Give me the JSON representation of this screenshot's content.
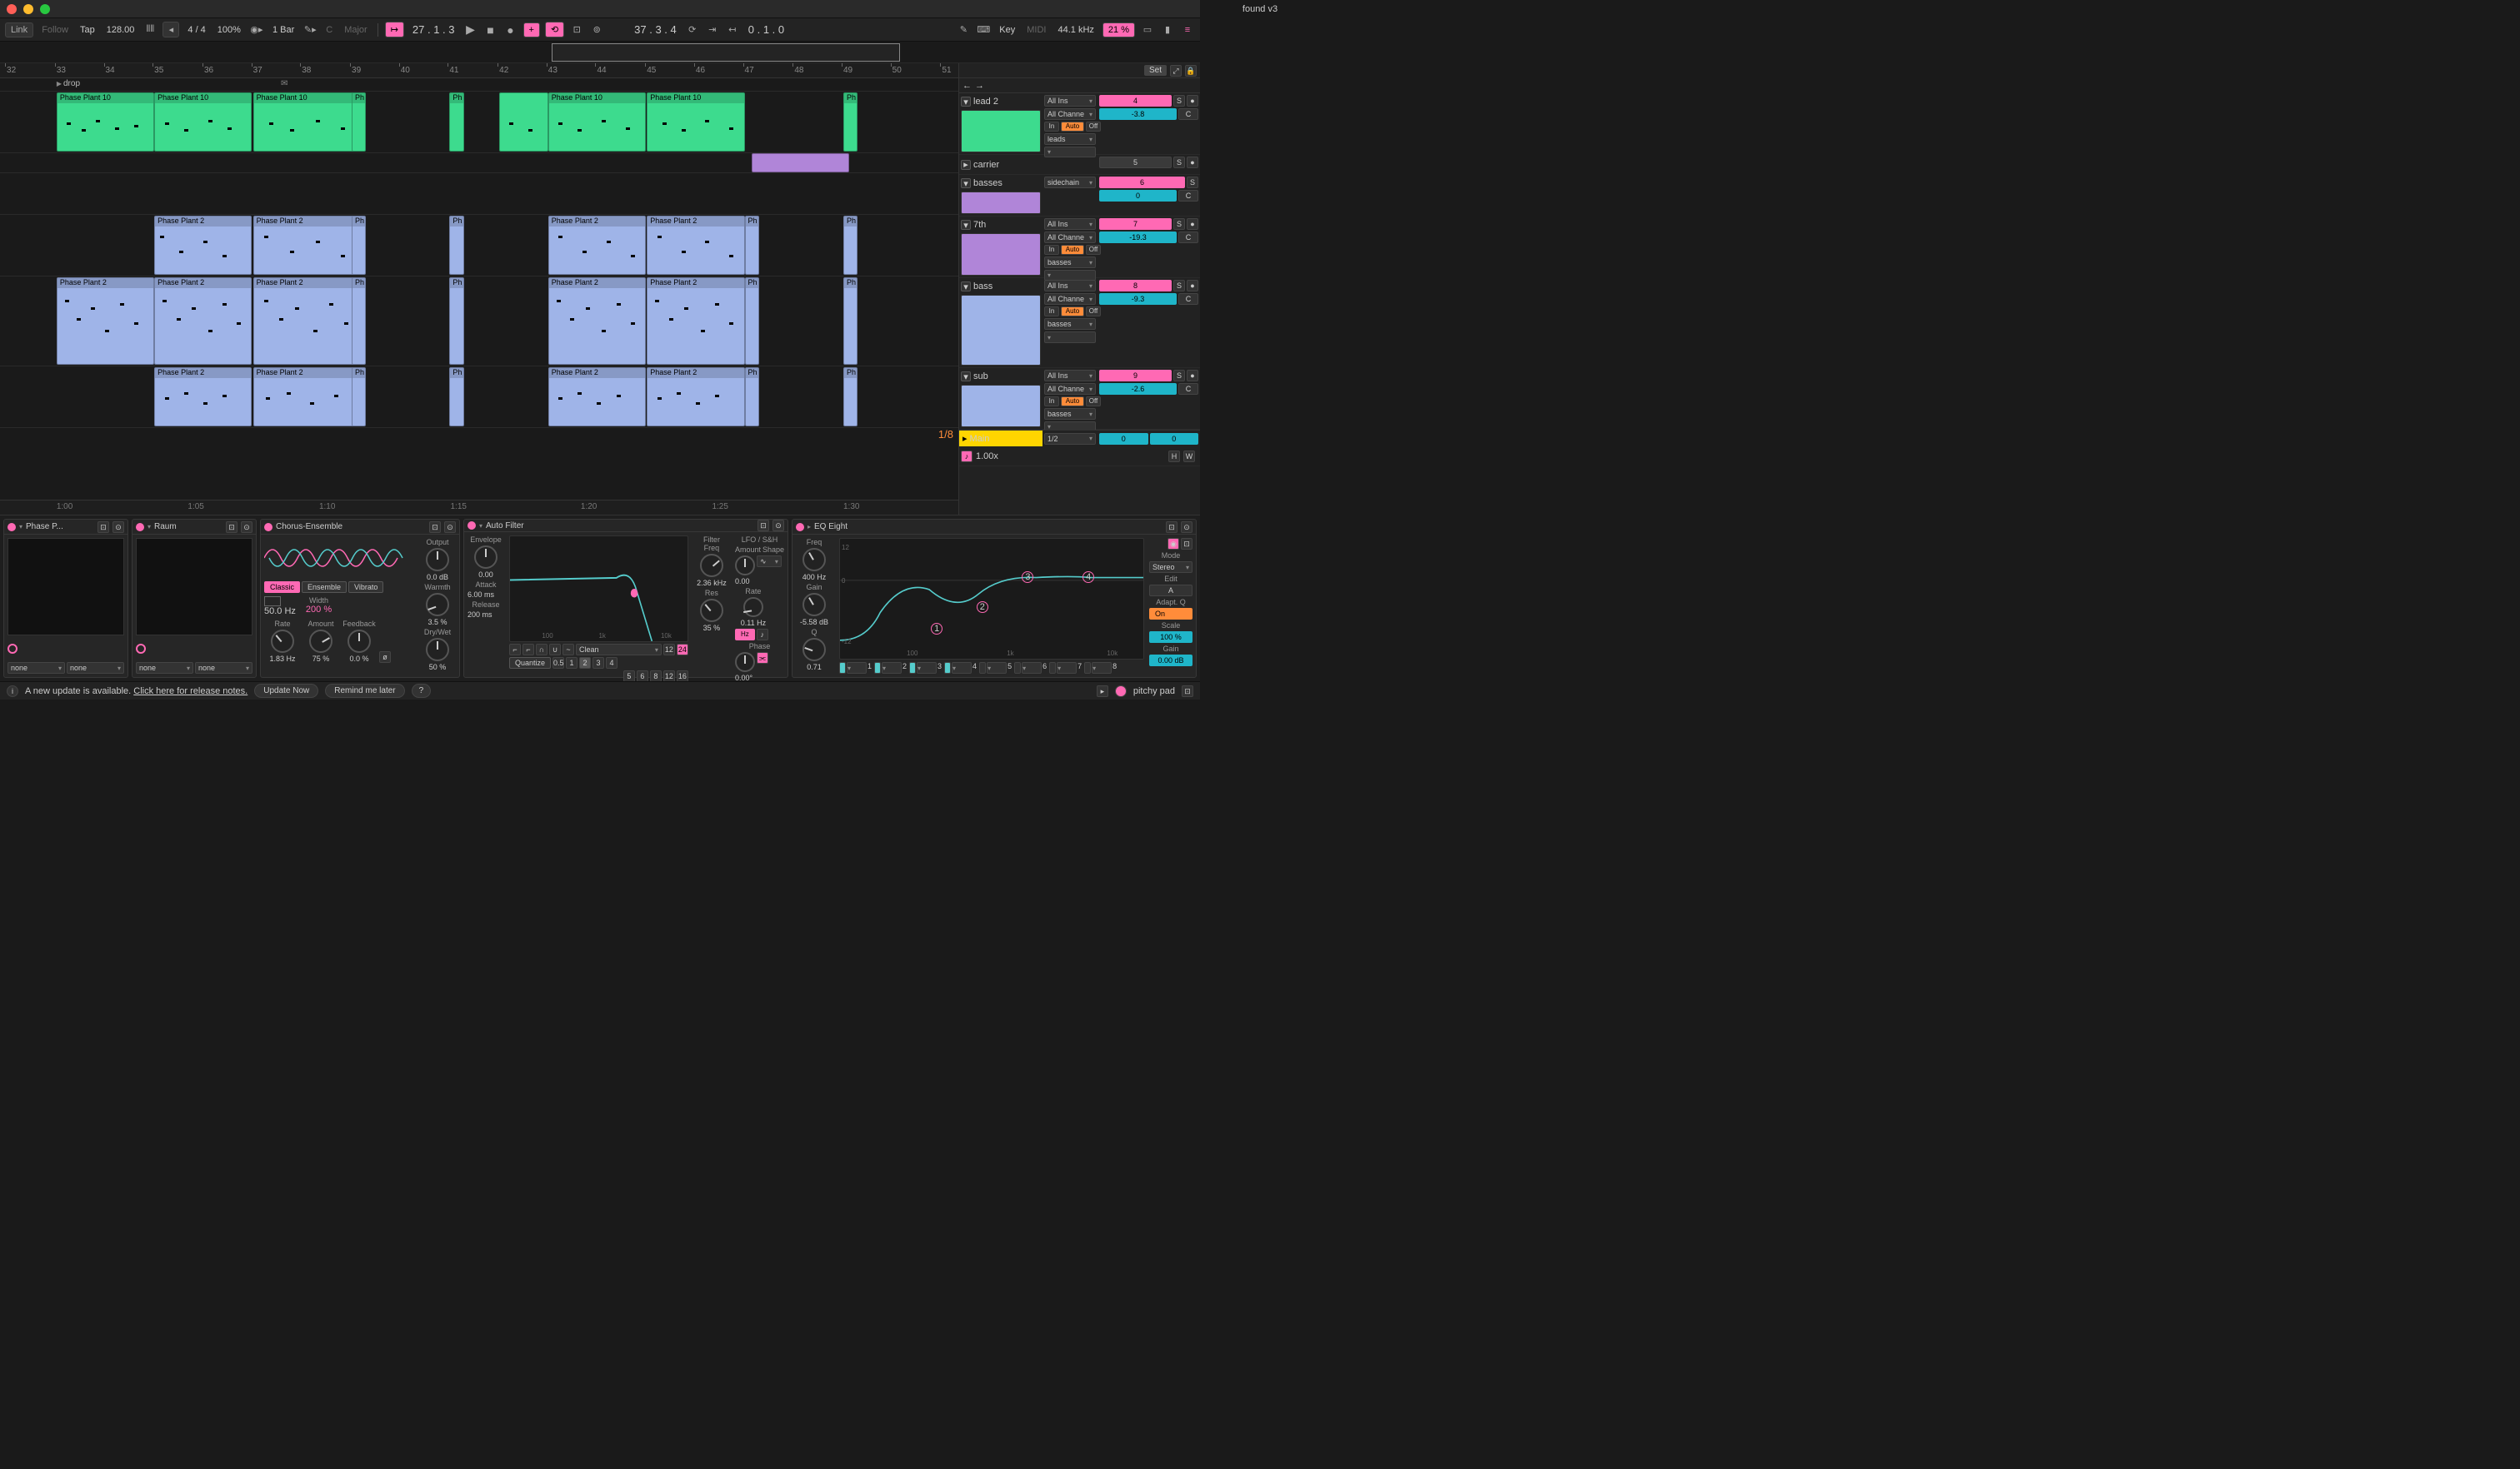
{
  "window_title": "found v3",
  "topbar": {
    "link": "Link",
    "follow": "Follow",
    "tap": "Tap",
    "tempo": "128.00",
    "time_sig": "4 / 4",
    "quant": "100%",
    "bars": "1 Bar",
    "key_root": "C",
    "key_scale": "Major",
    "bar_pos": "27 . 1 . 3",
    "punch_pos": "37 . 3 . 4",
    "end_pos": "0 . 1 . 0",
    "key_btn": "Key",
    "midi": "MIDI",
    "sample_rate": "44.1 kHz",
    "cpu": "21 %"
  },
  "ruler": {
    "bars": [
      "32",
      "33",
      "34",
      "35",
      "36",
      "37",
      "38",
      "39",
      "40",
      "41",
      "42",
      "43",
      "44",
      "45",
      "46",
      "47",
      "48",
      "49",
      "50",
      "51"
    ],
    "set": "Set"
  },
  "locator": "drop",
  "time_ruler": [
    "1:00",
    "1:05",
    "1:10",
    "1:15",
    "1:20",
    "1:25",
    "1:30"
  ],
  "grid_fraction": "1/8",
  "tracks": {
    "lead2": {
      "name": "lead 2",
      "input": "All Ins",
      "chan": "All Channe",
      "mon": "Auto",
      "out": "leads",
      "activator": "4",
      "vol": "-3.8",
      "solo": "S",
      "rec": "●",
      "pan": "C",
      "in_label": "In",
      "off_label": "Off"
    },
    "carrier": {
      "name": "carrier",
      "activator": "5",
      "solo": "S",
      "rec": "●"
    },
    "basses": {
      "name": "basses",
      "input": "sidechain",
      "activator": "6",
      "solo": "S",
      "vol": "0",
      "pan": "C"
    },
    "seventh": {
      "name": "7th",
      "input": "All Ins",
      "chan": "All Channe",
      "mon": "Auto",
      "out": "basses",
      "activator": "7",
      "vol": "-19.3",
      "solo": "S",
      "rec": "●",
      "pan": "C",
      "in_label": "In",
      "off_label": "Off"
    },
    "bass": {
      "name": "bass",
      "input": "All Ins",
      "chan": "All Channe",
      "mon": "Auto",
      "out": "basses",
      "activator": "8",
      "vol": "-9.3",
      "solo": "S",
      "rec": "●",
      "pan": "C",
      "in_label": "In",
      "off_label": "Off"
    },
    "sub": {
      "name": "sub",
      "input": "All Ins",
      "chan": "All Channe",
      "mon": "Auto",
      "out": "basses",
      "activator": "9",
      "vol": "-2.6",
      "solo": "S",
      "rec": "●",
      "pan": "C",
      "in_label": "In",
      "off_label": "Off"
    },
    "main": {
      "name": "Main",
      "out": "1/2",
      "cue": "0",
      "vol": "0"
    }
  },
  "tempo_row": {
    "label": "1.00x",
    "h": "H",
    "w": "W"
  },
  "clips": {
    "pp10": "Phase Plant 10",
    "pp2": "Phase Plant 2",
    "ph": "Ph"
  },
  "devices": {
    "phasep": {
      "title": "Phase P...",
      "chain_a": "none",
      "chain_b": "none"
    },
    "raum": {
      "title": "Raum",
      "chain_a": "none",
      "chain_b": "none"
    },
    "chorus": {
      "title": "Chorus-Ensemble",
      "mode_classic": "Classic",
      "mode_ensemble": "Ensemble",
      "mode_vibrato": "Vibrato",
      "width_label": "Width",
      "width": "200 %",
      "freq": "50.0 Hz",
      "rate_label": "Rate",
      "rate": "1.83 Hz",
      "amount_label": "Amount",
      "amount": "75 %",
      "fb_label": "Feedback",
      "fb": "0.0 %",
      "fb_inv": "ø",
      "out_label": "Output",
      "out": "0.0 dB",
      "warmth_label": "Warmth",
      "warmth": "3.5 %",
      "drywet_label": "Dry/Wet",
      "drywet": "50 %"
    },
    "autofilter": {
      "title": "Auto Filter",
      "env_label": "Envelope",
      "env": "0.00",
      "attack_label": "Attack",
      "attack": "6.00 ms",
      "release_label": "Release",
      "release": "200 ms",
      "freq_ticks": [
        "100",
        "1k",
        "10k"
      ],
      "filter_mode": "Clean",
      "filter_x": "12",
      "filter_y": "24",
      "quant_label": "Quantize",
      "quant_vals": [
        "0.5",
        "1",
        "2",
        "3",
        "4",
        "5",
        "6",
        "8",
        "12",
        "16"
      ],
      "filter_freq_label": "Filter\nFreq",
      "filter_freq": "2.36 kHz",
      "res_label": "Res",
      "res": "35 %",
      "lfo_label": "LFO / S&H",
      "lfo_amt_label": "Amount",
      "lfo_amt": "0.00",
      "lfo_shape_label": "Shape",
      "lfo_rate_label": "Rate",
      "lfo_rate": "0.11 Hz",
      "phase_label": "Phase",
      "phase": "0.00°",
      "hz": "Hz"
    },
    "eq": {
      "title": "EQ Eight",
      "freq_label": "Freq",
      "freq": "400 Hz",
      "gain_label": "Gain",
      "gain": "-5.58 dB",
      "q_label": "Q",
      "q": "0.71",
      "y_ticks": [
        "12",
        "0",
        "-12"
      ],
      "x_ticks": [
        "100",
        "1k",
        "10k"
      ],
      "bands": [
        "1",
        "2",
        "3",
        "4",
        "5",
        "6",
        "7",
        "8"
      ],
      "mode_label": "Mode",
      "mode": "Stereo",
      "edit_label": "Edit",
      "edit": "A",
      "adaptq_label": "Adapt. Q",
      "adaptq": "On",
      "scale_label": "Scale",
      "scale": "100 %",
      "gain2_label": "Gain",
      "gain2": "0.00 dB"
    }
  },
  "status": {
    "msg": "A new update is available.",
    "link": "Click here for release notes.",
    "update": "Update Now",
    "remind": "Remind me later",
    "help": "?",
    "track": "pitchy pad"
  }
}
